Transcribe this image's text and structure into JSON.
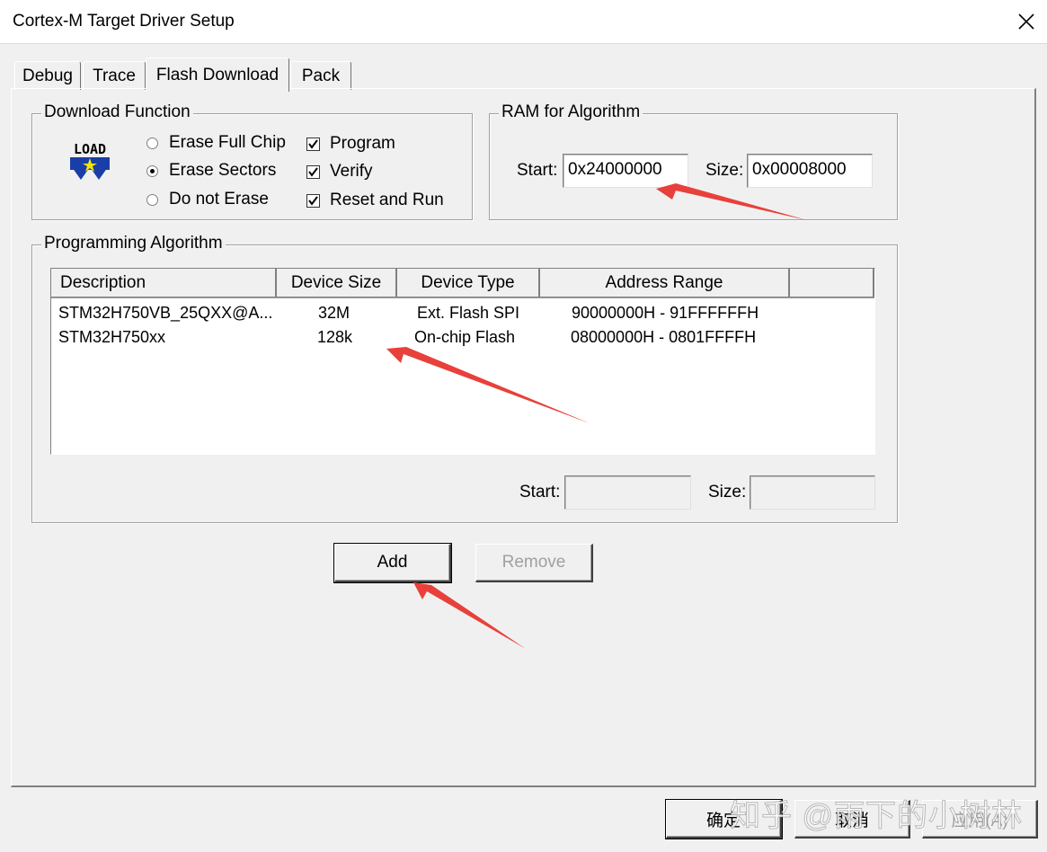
{
  "window": {
    "title": "Cortex-M Target Driver Setup"
  },
  "tabs": [
    {
      "label": "Debug"
    },
    {
      "label": "Trace"
    },
    {
      "label": "Flash Download",
      "active": true
    },
    {
      "label": "Pack"
    }
  ],
  "download_function": {
    "title": "Download Function",
    "icon": "load-icon",
    "icon_text": "LOAD",
    "radios": [
      {
        "label": "Erase Full Chip",
        "selected": false
      },
      {
        "label": "Erase Sectors",
        "selected": true
      },
      {
        "label": "Do not Erase",
        "selected": false
      }
    ],
    "checks": [
      {
        "label": "Program",
        "checked": true
      },
      {
        "label": "Verify",
        "checked": true
      },
      {
        "label": "Reset and Run",
        "checked": true
      }
    ]
  },
  "ram": {
    "title": "RAM for Algorithm",
    "start_label": "Start:",
    "start_value": "0x24000000",
    "size_label": "Size:",
    "size_value": "0x00008000"
  },
  "algorithm": {
    "title": "Programming Algorithm",
    "columns": [
      "Description",
      "Device Size",
      "Device Type",
      "Address Range"
    ],
    "rows": [
      {
        "description": "STM32H750VB_25QXX@A...",
        "size": "32M",
        "type": "Ext. Flash SPI",
        "range": "90000000H - 91FFFFFFH"
      },
      {
        "description": "STM32H750xx",
        "size": "128k",
        "type": "On-chip Flash",
        "range": "08000000H - 0801FFFFH"
      }
    ],
    "start_label": "Start:",
    "start_value": "",
    "size_label": "Size:",
    "size_value": ""
  },
  "buttons": {
    "add": "Add",
    "remove": "Remove",
    "ok": "确定",
    "cancel": "取消",
    "apply": "应用(A)"
  },
  "watermark": "知乎 @雨下的小树林",
  "colors": {
    "annotation_arrow": "#e8403a"
  }
}
